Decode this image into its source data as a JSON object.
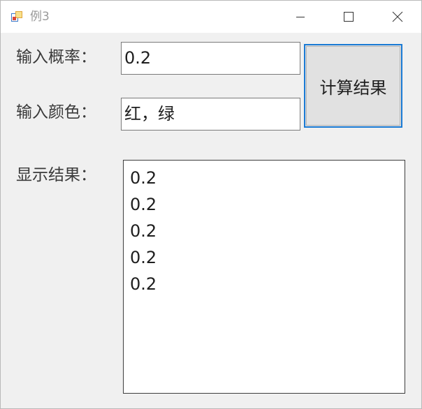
{
  "window": {
    "title": "例3",
    "controls": {
      "minimize": "minimize",
      "maximize": "maximize",
      "close": "close"
    }
  },
  "form": {
    "probability_label": "输入概率：",
    "probability_value": "0.2",
    "color_label": "输入颜色：",
    "color_value": "红，绿",
    "calculate_button": "计算结果",
    "result_label": "显示结果：",
    "results": [
      "0.2",
      "0.2",
      "0.2",
      "0.2",
      "0.2"
    ]
  },
  "colors": {
    "accent_focus": "#1a7ad4",
    "window_bg": "#f0f0f0",
    "button_bg": "#e1e1e1"
  }
}
